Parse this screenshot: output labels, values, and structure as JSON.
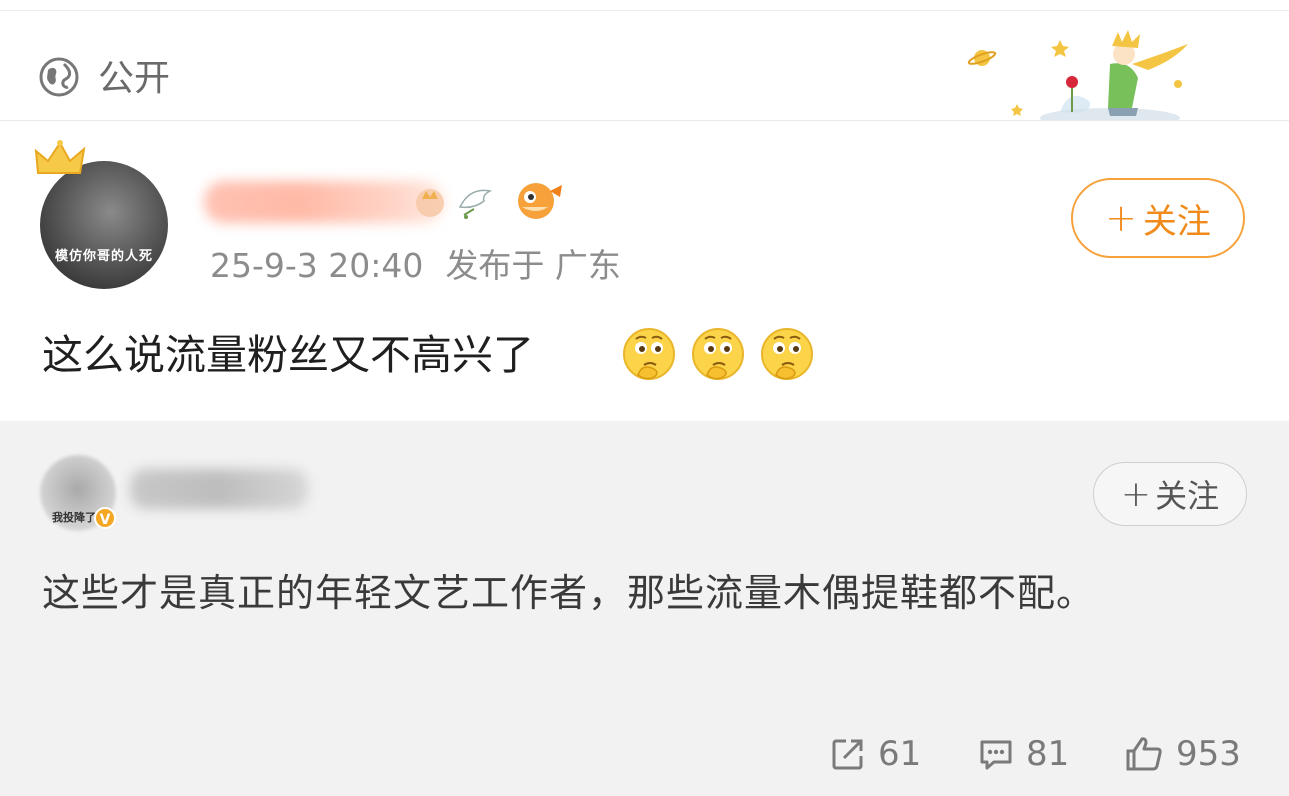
{
  "header": {
    "visibility_label": "公开",
    "globe_icon": "globe-icon",
    "banner": "little-prince-illustration"
  },
  "post": {
    "avatar_caption": "模仿你哥的人死",
    "timestamp": "25-9-3 20:40",
    "location": "发布于 广东",
    "follow_label": "关注",
    "text": "这么说流量粉丝又不高兴了",
    "emojis": [
      "thinking-face",
      "thinking-face",
      "thinking-face"
    ]
  },
  "reply": {
    "avatar_tag": "我投降了",
    "verified_mark": "V",
    "follow_label": "关注",
    "text": "这些才是真正的年轻文艺工作者，那些流量木偶提鞋都不配。"
  },
  "actions": {
    "repost_count": "61",
    "comment_count": "81",
    "like_count": "953"
  },
  "colors": {
    "accent": "#f08a1a",
    "reply_bg": "#f2f2f2",
    "meta_gray": "#8c8c8c"
  }
}
